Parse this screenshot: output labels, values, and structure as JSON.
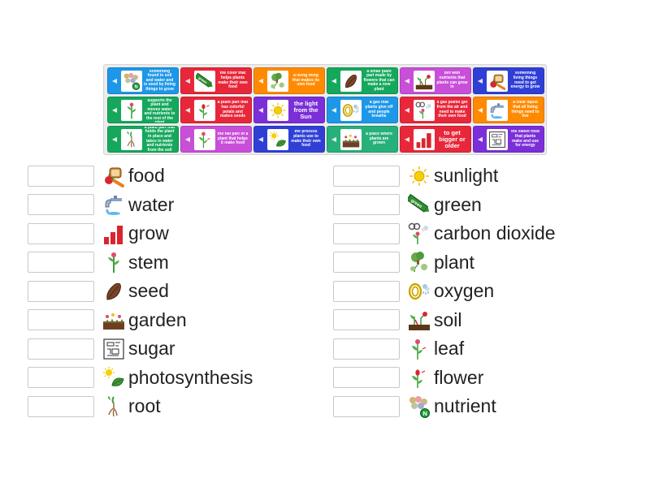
{
  "cards": [
    {
      "color": "#1d97e8",
      "text": "something found in soil and water and is used by living things to grow",
      "icon": "nutrient-icon"
    },
    {
      "color": "#e8273a",
      "text": "the color that helps plants make their own food",
      "icon": "green-crayon-icon"
    },
    {
      "color": "#ff8a00",
      "text": "a living thing that makes its own food",
      "icon": "plant-icon"
    },
    {
      "color": "#15a85c",
      "text": "a small plant part made by flowers that can make a new plant",
      "icon": "seed-icon"
    },
    {
      "color": "#c84fd8",
      "text": "dirt with nutrients that plants can grow in",
      "icon": "soil-icon"
    },
    {
      "color": "#2f3fd6",
      "text": "something living things need to get energy to grow",
      "icon": "food-icon"
    },
    {
      "color": "#15a85c",
      "text": "a plant part that supports the plant and moves water and nutrients to the rest of the plant",
      "icon": "stem-icon"
    },
    {
      "color": "#e8273a",
      "text": "a plant part that has colorful petals and makes seeds",
      "icon": "flower-icon"
    },
    {
      "color": "#7b2fd8",
      "text": "the light from the Sun",
      "icon": "sunlight-icon",
      "big": true
    },
    {
      "color": "#1d97e8",
      "text": "a gas that plants give off and people breathe",
      "icon": "oxygen-icon"
    },
    {
      "color": "#e8273a",
      "text": "a gas plants get from the air and need to make their own food",
      "icon": "carbon-dioxide-icon"
    },
    {
      "color": "#ff8a00",
      "text": "a clear liquid that all living things need to live",
      "icon": "water-icon"
    },
    {
      "color": "#15a85c",
      "text": "a plant part that holds the plant in place and takes in water and nutrients from the soil",
      "icon": "root-icon"
    },
    {
      "color": "#c84fd8",
      "text": "the flat part of a plant that helps it make food",
      "icon": "leaf-icon"
    },
    {
      "color": "#2f3fd6",
      "text": "the process plants use to make their own food",
      "icon": "photosynthesis-icon"
    },
    {
      "color": "#27b07a",
      "text": "a place where plants are grown",
      "icon": "garden-icon"
    },
    {
      "color": "#e8273a",
      "text": "to get bigger or older",
      "icon": "grow-icon",
      "big": true
    },
    {
      "color": "#7b2fd8",
      "text": "the sweet food that plants make and use for energy",
      "icon": "sugar-icon"
    }
  ],
  "left_words": [
    {
      "label": "food",
      "icon": "food-icon"
    },
    {
      "label": "water",
      "icon": "water-icon"
    },
    {
      "label": "grow",
      "icon": "grow-icon"
    },
    {
      "label": "stem",
      "icon": "stem-icon"
    },
    {
      "label": "seed",
      "icon": "seed-icon"
    },
    {
      "label": "garden",
      "icon": "garden-icon"
    },
    {
      "label": "sugar",
      "icon": "sugar-icon"
    },
    {
      "label": "photosynthesis",
      "icon": "photosynthesis-icon"
    },
    {
      "label": "root",
      "icon": "root-icon"
    }
  ],
  "right_words": [
    {
      "label": "sunlight",
      "icon": "sunlight-icon"
    },
    {
      "label": "green",
      "icon": "green-crayon-icon"
    },
    {
      "label": "carbon dioxide",
      "icon": "carbon-dioxide-icon"
    },
    {
      "label": "plant",
      "icon": "plant-icon"
    },
    {
      "label": "oxygen",
      "icon": "oxygen-icon"
    },
    {
      "label": "soil",
      "icon": "soil-icon"
    },
    {
      "label": "leaf",
      "icon": "leaf-icon"
    },
    {
      "label": "flower",
      "icon": "flower-icon"
    },
    {
      "label": "nutrient",
      "icon": "nutrient-icon"
    }
  ],
  "crayon_text": "green",
  "nutrient_letter": "N"
}
